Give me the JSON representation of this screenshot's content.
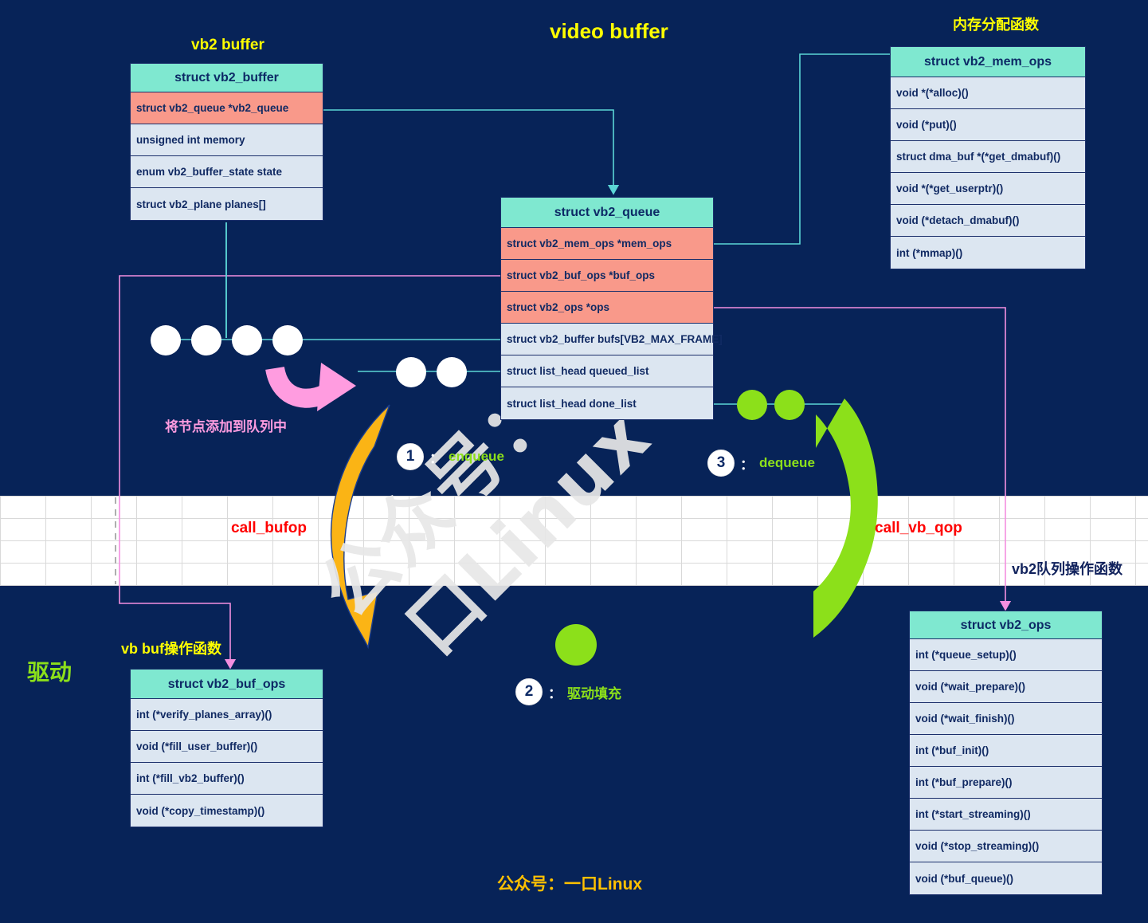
{
  "title": "video buffer",
  "footer": "公众号：一口Linux",
  "watermark": "公众号：一口Linux",
  "labels": {
    "vb2_buffer_caption": "vb2 buffer",
    "mem_ops_caption": "内存分配函数",
    "buf_ops_caption": "vb buf操作函数",
    "vb2_ops_caption": "vb2队列操作函数",
    "driver": "驱动",
    "add_node": "将节点添加到队列中",
    "call_bufop": "call_bufop",
    "call_vb_qop": "call_vb_qop"
  },
  "steps": [
    {
      "num": "1",
      "sep": "：",
      "text": "enqueue"
    },
    {
      "num": "2",
      "sep": "：",
      "text": "驱动填充"
    },
    {
      "num": "3",
      "sep": "：",
      "text": "dequeue"
    }
  ],
  "tables": {
    "vb2_buffer": {
      "header": "struct vb2_buffer",
      "rows": [
        {
          "text": "struct vb2_queue *vb2_queue",
          "highlight": true
        },
        {
          "text": "unsigned int memory",
          "highlight": false
        },
        {
          "text": "enum vb2_buffer_state    state",
          "highlight": false
        },
        {
          "text": "struct vb2_plane planes[]",
          "highlight": false
        }
      ]
    },
    "vb2_queue": {
      "header": "struct vb2_queue",
      "rows": [
        {
          "text": "struct vb2_mem_ops *mem_ops",
          "highlight": true
        },
        {
          "text": "struct vb2_buf_ops *buf_ops",
          "highlight": true
        },
        {
          "text": "struct vb2_ops    *ops",
          "highlight": true
        },
        {
          "text": "struct vb2_buffer bufs[VB2_MAX_FRAME]",
          "highlight": false
        },
        {
          "text": "struct list_head   queued_list",
          "highlight": false
        },
        {
          "text": "struct list_head   done_list",
          "highlight": false
        }
      ]
    },
    "vb2_mem_ops": {
      "header": "struct vb2_mem_ops",
      "rows": [
        {
          "text": "void *(*alloc)()",
          "highlight": false
        },
        {
          "text": "void (*put)()",
          "highlight": false
        },
        {
          "text": "struct dma_buf *(*get_dmabuf)()",
          "highlight": false
        },
        {
          "text": "void *(*get_userptr)()",
          "highlight": false
        },
        {
          "text": "void (*detach_dmabuf)()",
          "highlight": false
        },
        {
          "text": "int (*mmap)()",
          "highlight": false
        }
      ]
    },
    "vb2_buf_ops": {
      "header": "struct vb2_buf_ops",
      "rows": [
        {
          "text": "int (*verify_planes_array)()",
          "highlight": false
        },
        {
          "text": "void (*fill_user_buffer)()",
          "highlight": false
        },
        {
          "text": "int (*fill_vb2_buffer)()",
          "highlight": false
        },
        {
          "text": "void (*copy_timestamp)()",
          "highlight": false
        }
      ]
    },
    "vb2_ops": {
      "header": "struct vb2_ops",
      "rows": [
        {
          "text": "int (*queue_setup)()",
          "highlight": false
        },
        {
          "text": "void (*wait_prepare)()",
          "highlight": false
        },
        {
          "text": "void (*wait_finish)()",
          "highlight": false
        },
        {
          "text": "int (*buf_init)()",
          "highlight": false
        },
        {
          "text": "int (*buf_prepare)()",
          "highlight": false
        },
        {
          "text": "int (*start_streaming)()",
          "highlight": false
        },
        {
          "text": "void (*stop_streaming)()",
          "highlight": false
        },
        {
          "text": "void (*buf_queue)()",
          "highlight": false
        }
      ]
    }
  },
  "colors": {
    "background_navy": "#072358",
    "header_teal": "#7FE8D0",
    "row_blue": "#DCE6F1",
    "row_highlight": "#F9998A",
    "accent_yellow": "#FFFF00",
    "accent_gold": "#FFC000",
    "accent_green": "#8CE01A",
    "accent_orange": "#FBB415",
    "accent_pink": "#FF9CE0",
    "accent_red": "#FF0000",
    "link_cyan": "#5BD6D6",
    "link_magenta": "#F48FE0"
  }
}
